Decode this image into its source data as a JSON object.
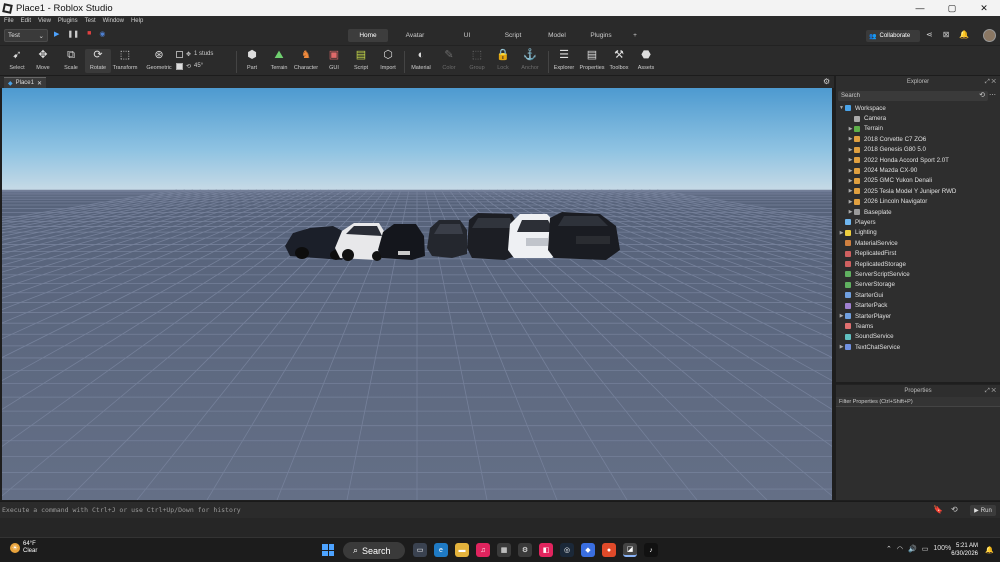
{
  "window": {
    "title": "Place1 - Roblox Studio",
    "controls": [
      "—",
      "▢",
      "✕"
    ]
  },
  "menu": [
    "File",
    "Edit",
    "View",
    "Plugins",
    "Test",
    "Window",
    "Help"
  ],
  "top": {
    "play_mode": "Test",
    "tabs": [
      "Home",
      "Avatar",
      "UI",
      "Script",
      "Model",
      "Plugins",
      "+"
    ],
    "active_tab": "Home",
    "collaborate": "Collaborate"
  },
  "ribbon": {
    "tools": [
      {
        "label": "Select",
        "icon": "pointer-icon"
      },
      {
        "label": "Move",
        "icon": "move-icon"
      },
      {
        "label": "Scale",
        "icon": "scale-icon"
      },
      {
        "label": "Rotate",
        "icon": "rotate-icon"
      },
      {
        "label": "Transform",
        "icon": "transform-icon"
      },
      {
        "label": "Geometric",
        "icon": "geometric-icon"
      }
    ],
    "snap": {
      "move": "1 studs",
      "rotate": "45°"
    },
    "insert": [
      {
        "label": "Part",
        "icon": "part-icon"
      },
      {
        "label": "Terrain",
        "icon": "terrain-icon"
      },
      {
        "label": "Character",
        "icon": "character-icon"
      },
      {
        "label": "GUI",
        "icon": "gui-icon"
      },
      {
        "label": "Script",
        "icon": "script-icon"
      },
      {
        "label": "Import",
        "icon": "import-icon"
      }
    ],
    "edit": [
      {
        "label": "Material",
        "icon": "material-icon"
      },
      {
        "label": "Color",
        "icon": "color-icon"
      },
      {
        "label": "Group",
        "icon": "group-icon"
      },
      {
        "label": "Lock",
        "icon": "lock-icon"
      },
      {
        "label": "Anchor",
        "icon": "anchor-icon"
      }
    ],
    "windows": [
      {
        "label": "Explorer",
        "icon": "explorer-icon"
      },
      {
        "label": "Properties",
        "icon": "properties-icon"
      },
      {
        "label": "Toolbox",
        "icon": "toolbox-icon"
      },
      {
        "label": "Assets",
        "icon": "assets-icon"
      }
    ]
  },
  "doc_tab": "Place1",
  "explorer": {
    "title": "Explorer",
    "search_placeholder": "Search",
    "nodes": [
      {
        "label": "Workspace",
        "depth": 0,
        "expanded": true,
        "color": "#4aa3e8"
      },
      {
        "label": "Camera",
        "depth": 1,
        "color": "#aaaaaa"
      },
      {
        "label": "Terrain",
        "depth": 1,
        "arrow": true,
        "color": "#5fb04a"
      },
      {
        "label": "2018 Corvette C7 ZO6",
        "depth": 1,
        "arrow": true,
        "color": "#e0a040"
      },
      {
        "label": "2018 Genesis G80 5.0",
        "depth": 1,
        "arrow": true,
        "color": "#e0a040"
      },
      {
        "label": "2022 Honda Accord Sport 2.0T",
        "depth": 1,
        "arrow": true,
        "color": "#e0a040"
      },
      {
        "label": "2024 Mazda CX-90",
        "depth": 1,
        "arrow": true,
        "color": "#e0a040"
      },
      {
        "label": "2025 GMC Yukon Denali",
        "depth": 1,
        "arrow": true,
        "color": "#e0a040"
      },
      {
        "label": "2025 Tesla Model Y Juniper RWD",
        "depth": 1,
        "arrow": true,
        "color": "#e0a040"
      },
      {
        "label": "2026 Lincoln Navigator",
        "depth": 1,
        "arrow": true,
        "color": "#e0a040"
      },
      {
        "label": "Baseplate",
        "depth": 1,
        "arrow": true,
        "color": "#9a9a9a"
      },
      {
        "label": "Players",
        "depth": 0,
        "color": "#6fb6f0"
      },
      {
        "label": "Lighting",
        "depth": 0,
        "arrow": true,
        "color": "#f0d040"
      },
      {
        "label": "MaterialService",
        "depth": 0,
        "color": "#d08040"
      },
      {
        "label": "ReplicatedFirst",
        "depth": 0,
        "color": "#d06060"
      },
      {
        "label": "ReplicatedStorage",
        "depth": 0,
        "color": "#d06060"
      },
      {
        "label": "ServerScriptService",
        "depth": 0,
        "color": "#60b060"
      },
      {
        "label": "ServerStorage",
        "depth": 0,
        "color": "#60b060"
      },
      {
        "label": "StarterGui",
        "depth": 0,
        "color": "#70a0e0"
      },
      {
        "label": "StarterPack",
        "depth": 0,
        "color": "#a080d0"
      },
      {
        "label": "StarterPlayer",
        "depth": 0,
        "arrow": true,
        "color": "#70a0e0"
      },
      {
        "label": "Teams",
        "depth": 0,
        "color": "#e07070"
      },
      {
        "label": "SoundService",
        "depth": 0,
        "color": "#60c0c0"
      },
      {
        "label": "TextChatService",
        "depth": 0,
        "arrow": true,
        "color": "#7090e0"
      }
    ]
  },
  "properties": {
    "title": "Properties",
    "filter_placeholder": "Filter Properties (Ctrl+Shift+P)"
  },
  "command_bar": {
    "placeholder": "Execute a command with Ctrl+J or use Ctrl+Up/Down for history",
    "run": "Run"
  },
  "taskbar": {
    "weather_temp": "64°F",
    "weather_desc": "Clear",
    "search": "Search",
    "battery": "100%",
    "time": "5:21 AM",
    "date": "6/30/2026"
  }
}
